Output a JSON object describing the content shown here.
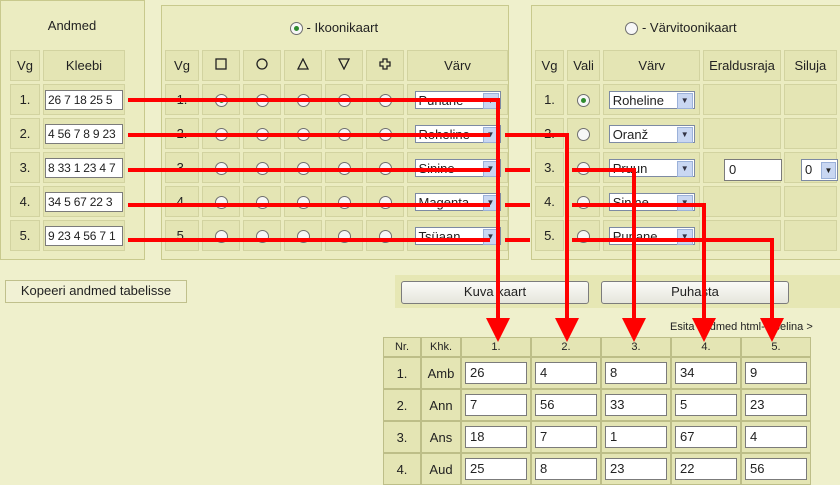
{
  "data_panel": {
    "title": "Andmed",
    "col_vg": "Vg",
    "col_kleebi": "Kleebi",
    "rows": [
      {
        "vg": "1.",
        "kleebi": "26 7 18 25 5"
      },
      {
        "vg": "2.",
        "kleebi": "4 56 7 8 9 23"
      },
      {
        "vg": "3.",
        "kleebi": "8 33 1 23 4 7"
      },
      {
        "vg": "4.",
        "kleebi": "34 5 67 22 3"
      },
      {
        "vg": "5.",
        "kleebi": "9 23 4 56 7 1"
      }
    ]
  },
  "icon_panel": {
    "title": " - Ikoonikaart",
    "selected": true,
    "col_vg": "Vg",
    "col_varv": "Värv",
    "shape_icons": [
      "square-icon",
      "circle-icon",
      "triangle-up-icon",
      "triangle-down-icon",
      "cross-icon"
    ],
    "rows": [
      {
        "vg": "1.",
        "shape": 0,
        "color": "Punane"
      },
      {
        "vg": "2.",
        "shape": -1,
        "color": "Roheline"
      },
      {
        "vg": "3.",
        "shape": -1,
        "color": "Sinine"
      },
      {
        "vg": "4.",
        "shape": -1,
        "color": "Magenta"
      },
      {
        "vg": "5.",
        "shape": -1,
        "color": "Tsüaan"
      }
    ]
  },
  "color_panel": {
    "title": " - Värvitoonikaart",
    "selected": false,
    "col_vg": "Vg",
    "col_vali": "Vali",
    "col_varv": "Värv",
    "col_eraldusraja": "Eraldusraja",
    "col_siluja": "Siluja",
    "eraldusraja_value": "0",
    "siluja_value": "0",
    "rows": [
      {
        "vg": "1.",
        "vali": true,
        "color": "Roheline"
      },
      {
        "vg": "2.",
        "vali": false,
        "color": "Oranž"
      },
      {
        "vg": "3.",
        "vali": false,
        "color": "Pruun"
      },
      {
        "vg": "4.",
        "vali": false,
        "color": "Sinine"
      },
      {
        "vg": "5.",
        "vali": false,
        "color": "Punane"
      }
    ]
  },
  "buttons": {
    "copy": "Kopeeri andmed tabelisse",
    "show_map": "Kuva kaart",
    "clear": "Puhasta"
  },
  "html_table_link": "Esita andmed html-tabelina >",
  "result_table": {
    "col_nr": "Nr.",
    "col_khk": "Khk.",
    "columns": [
      "1.",
      "2.",
      "3.",
      "4.",
      "5."
    ],
    "rows": [
      {
        "nr": "1.",
        "khk": "Amb",
        "values": [
          "26",
          "4",
          "8",
          "34",
          "9"
        ]
      },
      {
        "nr": "2.",
        "khk": "Ann",
        "values": [
          "7",
          "56",
          "33",
          "5",
          "23"
        ]
      },
      {
        "nr": "3.",
        "khk": "Ans",
        "values": [
          "18",
          "7",
          "1",
          "67",
          "4"
        ]
      },
      {
        "nr": "4.",
        "khk": "Aud",
        "values": [
          "25",
          "8",
          "23",
          "22",
          "56"
        ]
      }
    ]
  },
  "colors": {
    "background": "#eff0cc",
    "panel": "#ebecc1",
    "arrow": "#ff0000",
    "radio_dot": "#2e8b2e"
  }
}
